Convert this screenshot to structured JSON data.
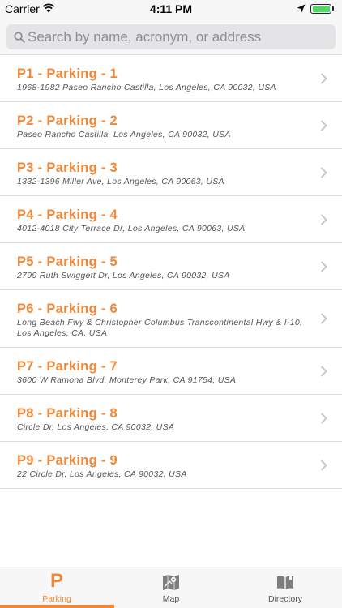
{
  "status_bar": {
    "carrier": "Carrier",
    "time": "4:11 PM"
  },
  "search": {
    "placeholder": "Search by name, acronym, or address"
  },
  "colors": {
    "accent": "#f0883a",
    "battery": "#4cd964"
  },
  "parking_lots": [
    {
      "title": "P1 - Parking - 1",
      "address": "1968-1982 Paseo Rancho Castilla, Los Angeles, CA 90032, USA"
    },
    {
      "title": "P2 - Parking - 2",
      "address": "Paseo Rancho Castilla, Los Angeles, CA 90032, USA"
    },
    {
      "title": "P3 - Parking - 3",
      "address": "1332-1396 Miller Ave, Los Angeles, CA 90063, USA"
    },
    {
      "title": "P4 - Parking - 4",
      "address": "4012-4018 City Terrace Dr, Los Angeles, CA 90063, USA"
    },
    {
      "title": "P5 - Parking - 5",
      "address": "2799 Ruth Swiggett Dr, Los Angeles, CA 90032, USA"
    },
    {
      "title": "P6 - Parking - 6",
      "address": "Long Beach Fwy & Christopher Columbus Transcontinental Hwy & I-10, Los Angeles, CA, USA"
    },
    {
      "title": "P7 - Parking - 7",
      "address": "3600 W Ramona Blvd, Monterey Park, CA 91754, USA"
    },
    {
      "title": "P8 - Parking - 8",
      "address": "Circle Dr, Los Angeles, CA 90032, USA"
    },
    {
      "title": "P9 - Parking - 9",
      "address": "22 Circle Dr, Los Angeles, CA 90032, USA"
    }
  ],
  "tabs": [
    {
      "label": "Parking",
      "icon": "parking-icon",
      "active": true
    },
    {
      "label": "Map",
      "icon": "map-icon",
      "active": false
    },
    {
      "label": "Directory",
      "icon": "book-icon",
      "active": false
    }
  ]
}
